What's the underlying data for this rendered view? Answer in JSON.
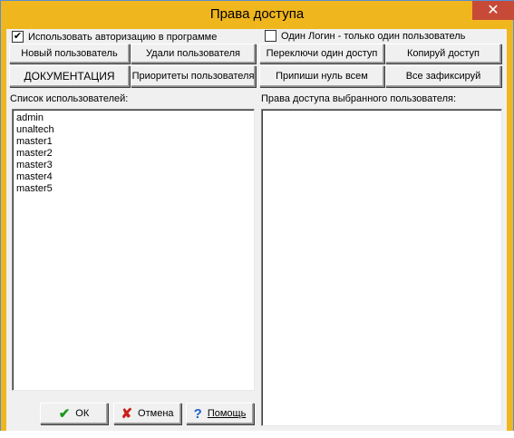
{
  "window": {
    "title": "Права доступа",
    "close_glyph": "✕"
  },
  "options": {
    "use_auth": {
      "label": "Использовать авторизацию в программе",
      "checked": true
    },
    "one_login": {
      "label": "Один Логин - только один пользователь",
      "checked": false
    }
  },
  "buttons": {
    "new_user": "Новый пользователь",
    "delete_user": "Удали пользователя",
    "toggle_one_access": "Переключи один доступ",
    "copy_access": "Копируй доступ",
    "documentation": "ДОКУМЕНТАЦИЯ",
    "user_priorities": "Приоритеты пользователя",
    "assign_zero_all": "Припиши нуль всем",
    "fix_all": "Все зафиксируй",
    "ok": "ОК",
    "cancel": "Отмена",
    "help": "Помощь"
  },
  "users_panel": {
    "label": "Список использователей:",
    "items": [
      "admin",
      "unaltech",
      "master1",
      "master2",
      "master3",
      "master4",
      "master5"
    ]
  },
  "rights_panel": {
    "label": "Права доступа выбранного пользователя:",
    "items": []
  },
  "icons": {
    "ok": "check-icon",
    "cancel": "x-icon",
    "help": "question-icon"
  },
  "colors": {
    "title_bar": "#f0b61e",
    "close_button": "#c74a39",
    "client": "#f0f0f0",
    "ok_icon": "#1a9a1a",
    "cancel_icon": "#c8201a",
    "help_icon": "#1e5fc8"
  }
}
